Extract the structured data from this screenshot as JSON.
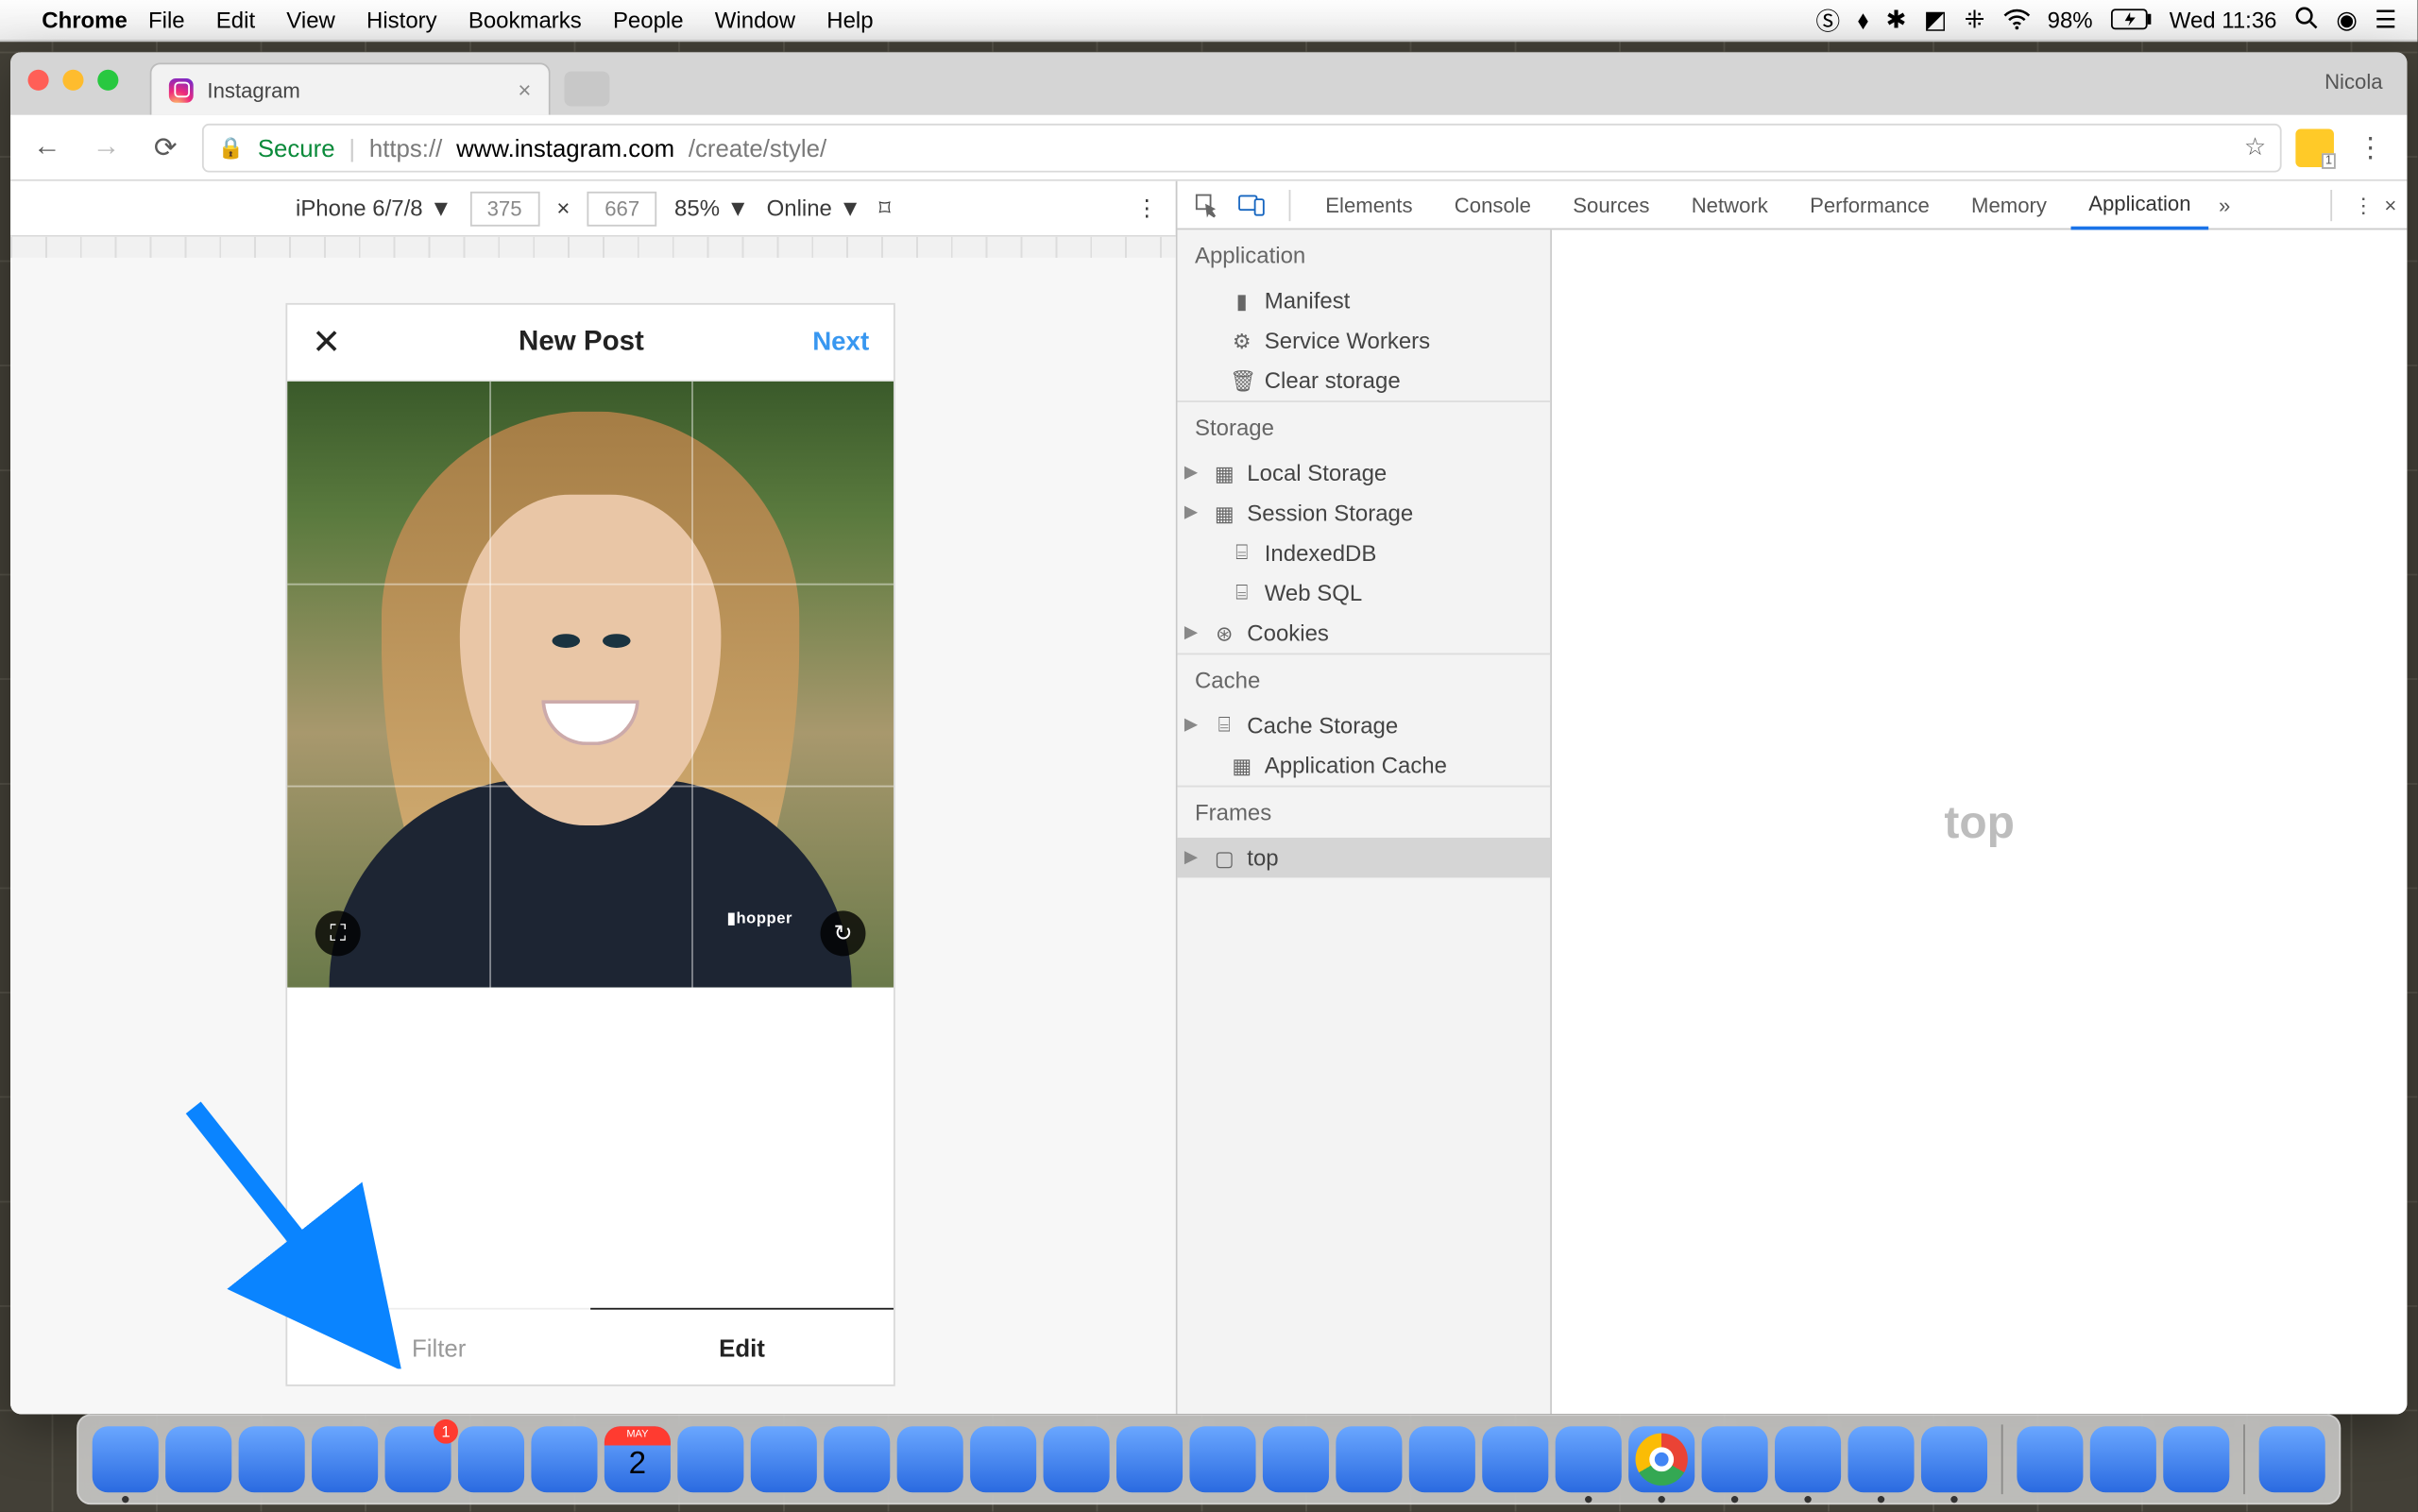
{
  "menubar": {
    "app": "Chrome",
    "items": [
      "File",
      "Edit",
      "View",
      "History",
      "Bookmarks",
      "People",
      "Window",
      "Help"
    ],
    "battery": "98%",
    "clock": "Wed 11:36"
  },
  "chrome": {
    "profile": "Nicola",
    "tab_title": "Instagram",
    "secure": "Secure",
    "url_scheme": "https://",
    "url_host": "www.instagram.com",
    "url_path": "/create/style/"
  },
  "devicebar": {
    "device": "iPhone 6/7/8",
    "w": "375",
    "h": "667",
    "zoom": "85%",
    "throttle": "Online"
  },
  "ig": {
    "title": "New Post",
    "next": "Next",
    "filter": "Filter",
    "edit": "Edit",
    "shirt_logo": "▮hopper"
  },
  "calendar": {
    "month": "MAY",
    "day": "2"
  },
  "devtools": {
    "tabs": [
      "Elements",
      "Console",
      "Sources",
      "Network",
      "Performance",
      "Memory",
      "Application"
    ],
    "active_tab": "Application",
    "main_placeholder": "top",
    "sections": {
      "application": {
        "label": "Application",
        "items": [
          "Manifest",
          "Service Workers",
          "Clear storage"
        ]
      },
      "storage": {
        "label": "Storage",
        "items": [
          "Local Storage",
          "Session Storage",
          "IndexedDB",
          "Web SQL",
          "Cookies"
        ]
      },
      "cache": {
        "label": "Cache",
        "items": [
          "Cache Storage",
          "Application Cache"
        ]
      },
      "frames": {
        "label": "Frames",
        "items": [
          "top"
        ]
      }
    }
  },
  "appstore_badge": "1"
}
